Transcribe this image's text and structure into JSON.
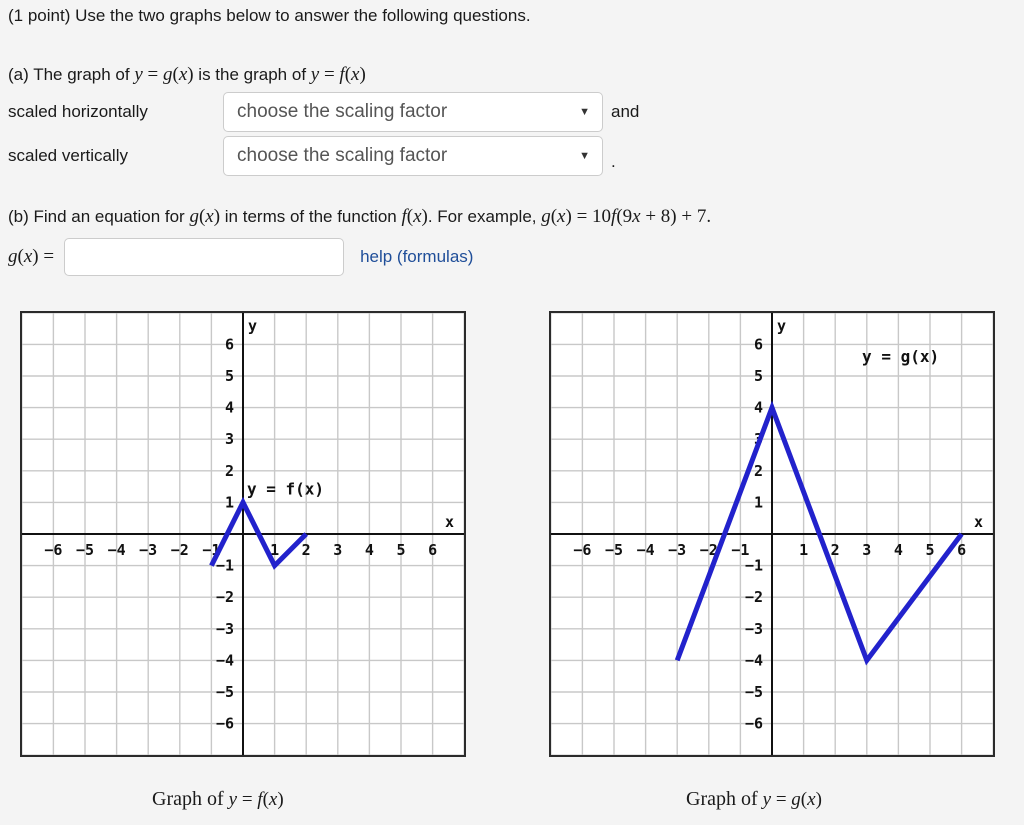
{
  "problem": {
    "points_label": "(1 point) Use the two graphs below to answer the following questions.",
    "part_a": {
      "prefix": "(a) The graph of ",
      "g_of_x": "y = g(x)",
      "middle": " is the graph of ",
      "f_of_x": "y = f(x)",
      "horizontal_label": "scaled horizontally",
      "vertical_label": "scaled vertically",
      "select_placeholder": "choose the scaling factor",
      "caret_glyph": "▼",
      "conjunction": "and",
      "period": "."
    },
    "part_b": {
      "text_before": "(b) Find an equation for ",
      "g_of_x": "g(x)",
      "text_middle": " in terms of the function ",
      "f_of_x": "f(x)",
      "text_after": ". For example, ",
      "example_equation": "g(x) = 10f(9x + 8) + 7.",
      "answer_prefix": "g(x) =",
      "answer_value": "",
      "answer_placeholder": "",
      "help_link_label": "help (formulas)"
    }
  },
  "captions": {
    "graph_f": "Graph of y = f(x)",
    "graph_g": "Graph of y = g(x)"
  },
  "colors": {
    "curve": "#2222cc",
    "axis": "#111111",
    "grid": "#c8c8c8",
    "border": "#2b2b2b",
    "page_bg": "#f4f4f4",
    "link": "#1f4e99",
    "placeholder_text": "#555555"
  },
  "chart_data": [
    {
      "type": "line",
      "id": "graph-f",
      "title": "y = f(x)",
      "in_plot_label": "y = f(x)",
      "xlabel": "x",
      "ylabel": "y",
      "xlim": [
        -7,
        7
      ],
      "ylim": [
        -7,
        7
      ],
      "grid": true,
      "x_ticks": [
        -6,
        -5,
        -4,
        -3,
        -2,
        -1,
        1,
        2,
        3,
        4,
        5,
        6
      ],
      "x_tick_labels": [
        "−6",
        "−5",
        "−4",
        "−3",
        "−2",
        "−1",
        "1",
        "2",
        "3",
        "4",
        "5",
        "6"
      ],
      "y_ticks": [
        6,
        5,
        4,
        3,
        2,
        1,
        -1,
        -2,
        -3,
        -4,
        -5,
        -6
      ],
      "y_tick_labels": [
        "6",
        "5",
        "4",
        "3",
        "2",
        "1",
        "−1",
        "−2",
        "−3",
        "−4",
        "−5",
        "−6"
      ],
      "series": [
        {
          "name": "f",
          "color": "#2222cc",
          "points": [
            [
              -1,
              -1
            ],
            [
              0,
              1
            ],
            [
              1,
              -1
            ],
            [
              2,
              0
            ]
          ]
        }
      ]
    },
    {
      "type": "line",
      "id": "graph-g",
      "title": "y = g(x)",
      "in_plot_label": "y = g(x)",
      "xlabel": "x",
      "ylabel": "y",
      "xlim": [
        -7,
        7
      ],
      "ylim": [
        -7,
        7
      ],
      "grid": true,
      "x_ticks": [
        -6,
        -5,
        -4,
        -3,
        -2,
        -1,
        1,
        2,
        3,
        4,
        5,
        6
      ],
      "x_tick_labels": [
        "−6",
        "−5",
        "−4",
        "−3",
        "−2",
        "−1",
        "1",
        "2",
        "3",
        "4",
        "5",
        "6"
      ],
      "y_ticks": [
        6,
        5,
        4,
        3,
        2,
        1,
        -1,
        -2,
        -3,
        -4,
        -5,
        -6
      ],
      "y_tick_labels": [
        "6",
        "5",
        "4",
        "3",
        "2",
        "1",
        "−1",
        "−2",
        "−3",
        "−4",
        "−5",
        "−6"
      ],
      "series": [
        {
          "name": "g",
          "color": "#2222cc",
          "points": [
            [
              -3,
              -4
            ],
            [
              0,
              4
            ],
            [
              3,
              -4
            ],
            [
              6,
              0
            ]
          ]
        }
      ]
    }
  ]
}
